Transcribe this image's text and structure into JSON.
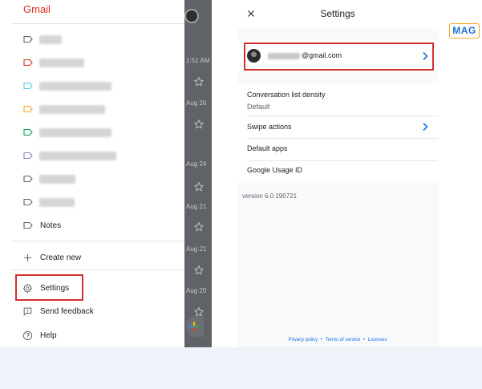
{
  "drawer": {
    "app_name": "Gmail",
    "labels": [
      {
        "color": "#5f6368",
        "blur_width": 28
      },
      {
        "color": "#d93025",
        "blur_width": 56
      },
      {
        "color": "#4ecde6",
        "blur_width": 90
      },
      {
        "color": "#f6a623",
        "blur_width": 82
      },
      {
        "color": "#0f9d58",
        "blur_width": 90
      },
      {
        "color": "#8e7cc3",
        "blur_width": 96
      },
      {
        "color": "#5f6368",
        "blur_width": 45
      },
      {
        "color": "#5f6368",
        "blur_width": 44
      }
    ],
    "notes_label": "Notes",
    "create_new_label": "Create new",
    "settings_label": "Settings",
    "send_feedback_label": "Send feedback",
    "help_label": "Help"
  },
  "inbox_peek": {
    "dates": [
      "1:51 AM",
      "Aug 26",
      "Aug 24",
      "Aug 21",
      "Aug 21",
      "Aug 20"
    ]
  },
  "settings": {
    "title": "Settings",
    "account_email_suffix": "@gmail.com",
    "rows": {
      "density_label": "Conversation list density",
      "density_value": "Default",
      "swipe_label": "Swipe actions",
      "default_apps_label": "Default apps",
      "usage_id_label": "Google Usage ID"
    },
    "version": "version 6.0.190721",
    "footer": {
      "privacy": "Privacy policy",
      "terms": "Terms of service",
      "licenses": "Licenses",
      "separator": "•"
    }
  },
  "watermark": {
    "text": "MAG"
  },
  "colors": {
    "gmail_red": "#d93025",
    "highlight_red": "#d32f2f",
    "link_blue": "#1a73e8",
    "chevron_blue": "#1a73e8"
  }
}
